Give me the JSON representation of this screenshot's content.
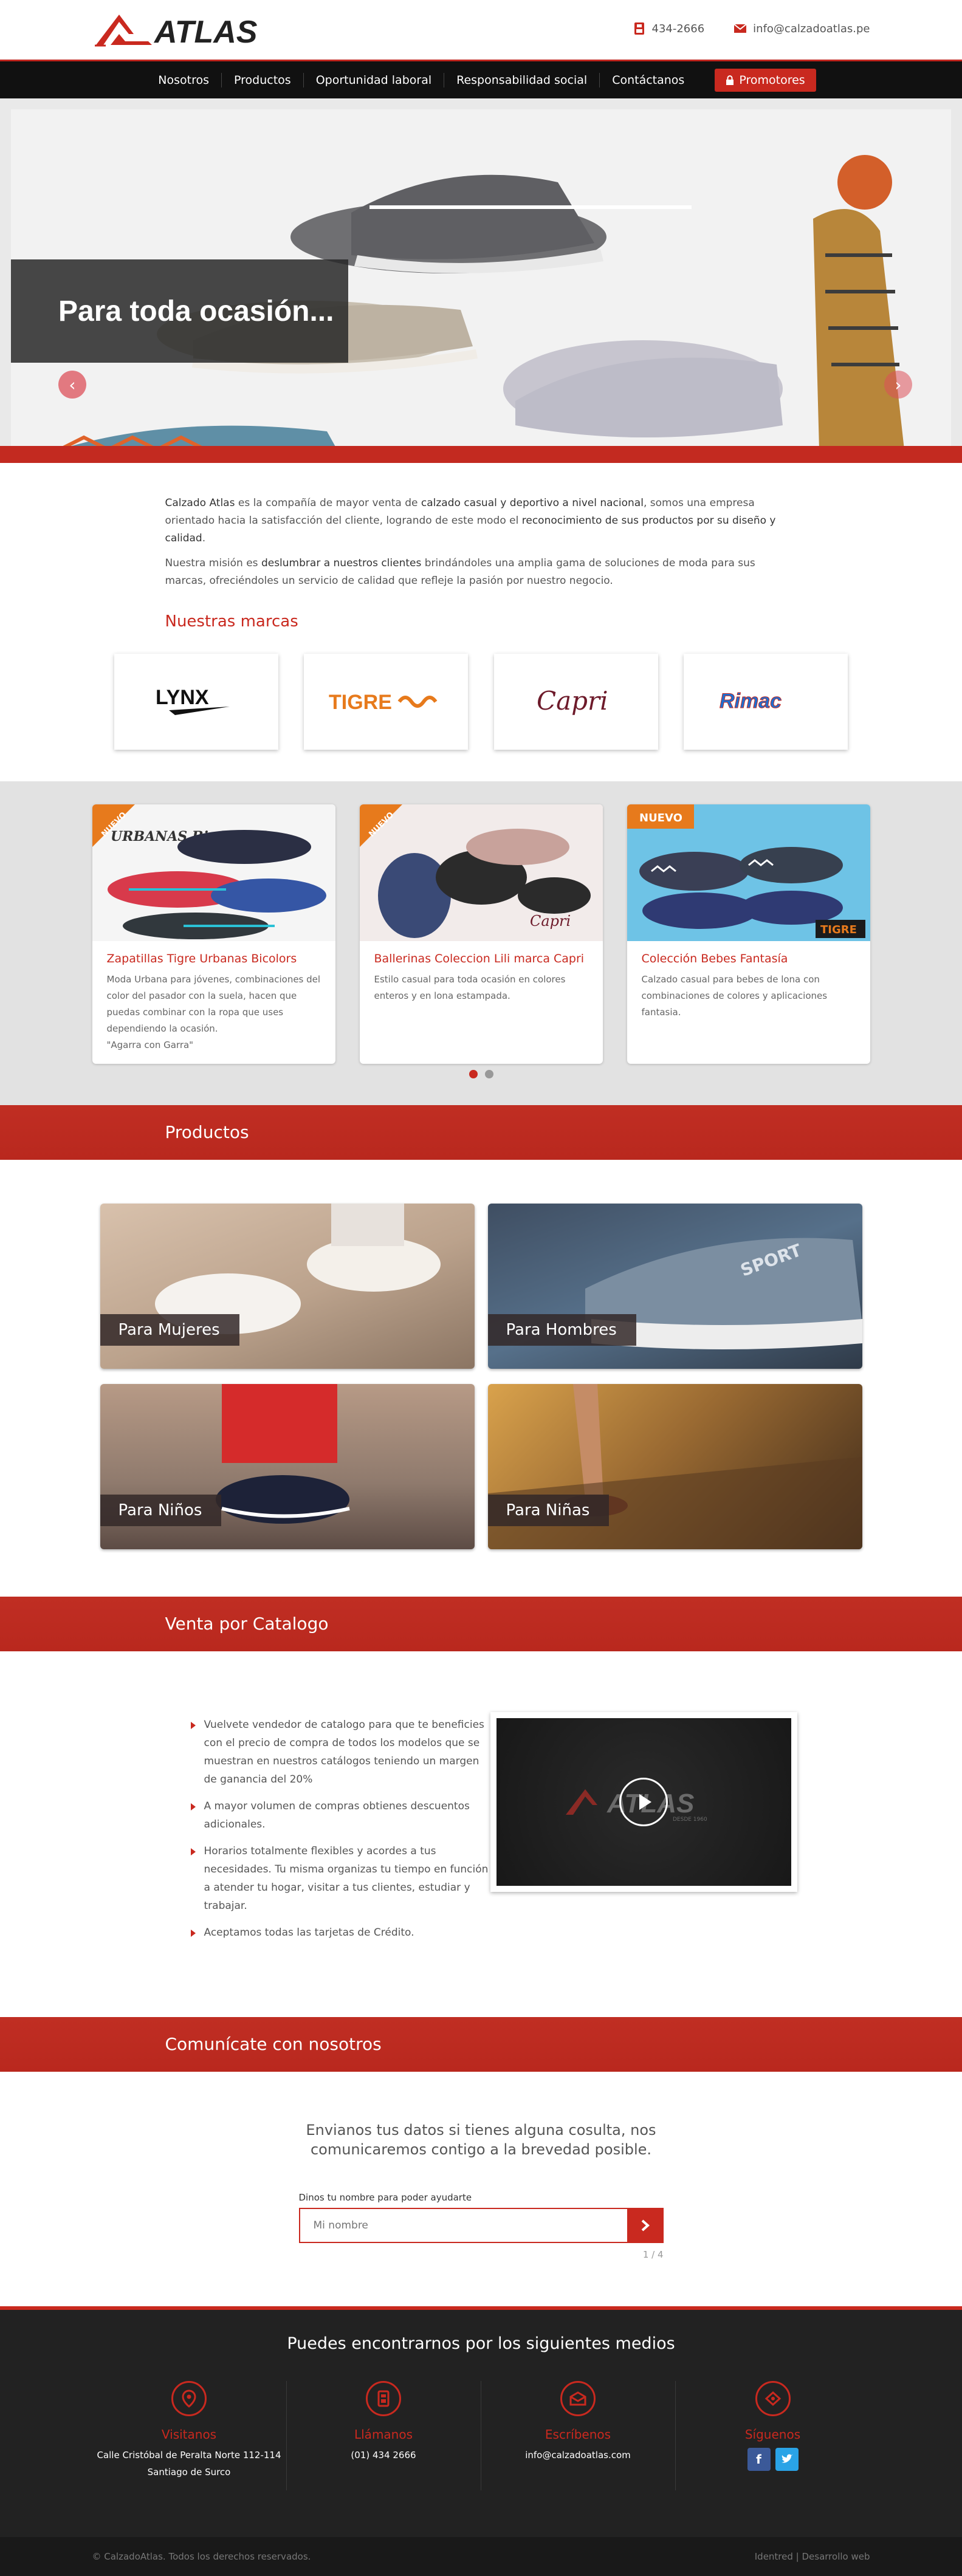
{
  "header": {
    "logo_text": "ATLAS",
    "phone": "434-2666",
    "email": "info@calzadoatlas.pe"
  },
  "nav": {
    "items": [
      "Nosotros",
      "Productos",
      "Oportunidad laboral",
      "Responsabilidad social",
      "Contáctanos"
    ],
    "promo_label": "Promotores"
  },
  "hero": {
    "caption": "Para toda ocasión..."
  },
  "intro": {
    "p1": [
      {
        "t": "Calzado Atlas",
        "b": true
      },
      {
        "t": " es la compañía de mayor venta de ",
        "b": false
      },
      {
        "t": "calzado casual y deportivo a nivel nacional",
        "b": true
      },
      {
        "t": ", somos una empresa orientado hacia la satisfacción del cliente, logrando de este modo el ",
        "b": false
      },
      {
        "t": "reconocimiento de sus productos por su diseño y calidad",
        "b": true
      },
      {
        "t": ".",
        "b": false
      }
    ],
    "p2": [
      {
        "t": "Nuestra misión es ",
        "b": false
      },
      {
        "t": "deslumbrar a nuestros clientes",
        "b": true
      },
      {
        "t": " brindándoles una amplia gama de soluciones de moda para sus marcas, ofreciéndoles un servicio de calidad que refleje la pasión por nuestro negocio.",
        "b": false
      }
    ]
  },
  "brands": {
    "heading": "Nuestras marcas",
    "items": [
      "LYNX",
      "TIGRE",
      "Capri",
      "Rimac"
    ]
  },
  "promos": {
    "cards": [
      {
        "title": "Zapatillas Tigre Urbanas Bicolors",
        "text": "Moda Urbana para jóvenes, combinaciones del color del pasador con la suela, hacen que puedas combinar con la ropa que uses dependiendo la ocasión.",
        "quote": "\"Agarra con Garra\"",
        "badge": "NUEVO",
        "img_text": "URBANAS Bicolors"
      },
      {
        "title": "Ballerinas Coleccion Lili marca Capri",
        "text": "Estilo casual para toda ocasión en colores enteros y en lona estampada.",
        "quote": "",
        "badge": "NUEVO",
        "img_text": "Capri"
      },
      {
        "title": "Colección Bebes Fantasía",
        "text": "Calzado casual para bebes de lona con combinaciones de colores y aplicaciones fantasia.",
        "quote": "",
        "badge": "NUEVO",
        "img_text": "TIGRE"
      }
    ],
    "slide_count": 2,
    "active_slide": 1
  },
  "products": {
    "heading": "Productos",
    "tiles": [
      "Para Mujeres",
      "Para Hombres",
      "Para Niños",
      "Para Niñas"
    ]
  },
  "catalog": {
    "heading": "Venta por Catalogo",
    "items": [
      "Vuelvete vendedor de catalogo para que te beneficies con el precio de compra de todos los modelos que se muestran en nuestros catálogos teniendo un margen de ganancia del 20%",
      "A mayor volumen de compras obtienes descuentos adicionales.",
      "Horarios totalmente flexibles y acordes a tus necesidades. Tu misma organizas tu tiempo en función a atender tu hogar, visitar a tus clientes, estudiar y trabajar.",
      "Aceptamos todas las tarjetas de Crédito."
    ],
    "video_logo": "ATLAS",
    "video_sub": "DESDE 1960"
  },
  "contact": {
    "heading": "Comunícate con nosotros",
    "intro": "Envianos tus datos si tienes alguna cosulta, nos comunicaremos contigo a la brevedad posible.",
    "label": "Dinos tu nombre para poder ayudarte",
    "placeholder": "Mi nombre",
    "step": "1 / 4"
  },
  "footer": {
    "heading": "Puedes encontrarnos por los siguientes medios",
    "cols": [
      {
        "title": "Visitanos",
        "line1": "Calle Cristóbal de Peralta Norte 112-114",
        "line2": "Santiago de Surco"
      },
      {
        "title": "Llámanos",
        "line1": "(01) 434 2666",
        "line2": ""
      },
      {
        "title": "Escríbenos",
        "line1": "info@calzadoatlas.com",
        "line2": ""
      },
      {
        "title": "Síguenos",
        "line1": "",
        "line2": ""
      }
    ],
    "copyright": "© CalzadoAtlas. Todos los derechos reservados.",
    "credit": "Identred | Desarrollo web"
  },
  "colors": {
    "brand_red": "#c9291f",
    "nav_bg": "#111111",
    "footer_bg": "#222222",
    "facebook": "#3b5998",
    "twitter": "#2aa3e6"
  }
}
